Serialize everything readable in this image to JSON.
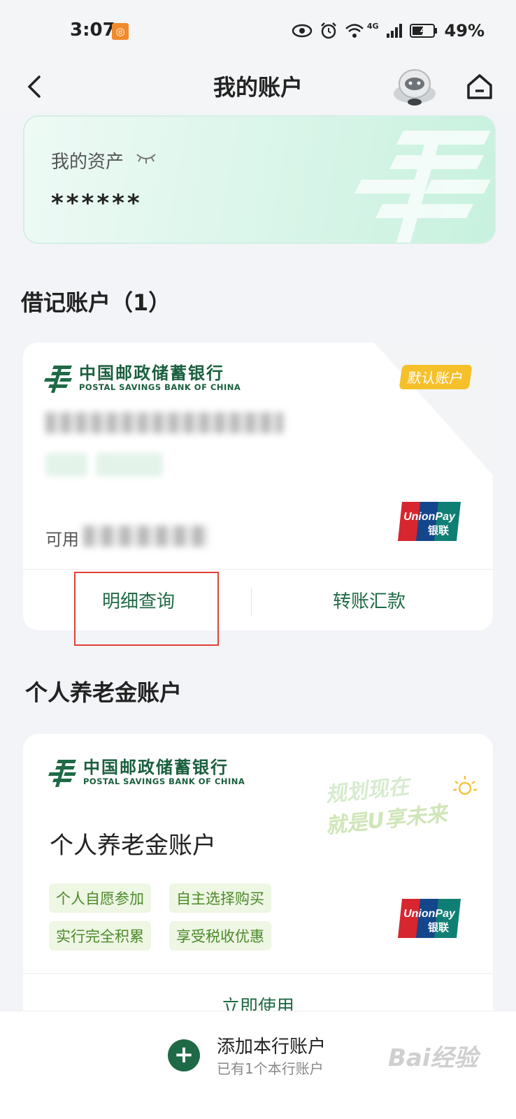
{
  "status_bar": {
    "time": "3:07",
    "battery": "49%",
    "network": "4G"
  },
  "header": {
    "title": "我的账户"
  },
  "assets": {
    "label": "我的资产",
    "value": "******"
  },
  "debit_section": {
    "title": "借记账户（1）"
  },
  "debit_card": {
    "bank_name_cn": "中国邮政储蓄银行",
    "bank_name_en": "POSTAL SAVINGS BANK OF CHINA",
    "badge": "默认账户",
    "available_label": "可用",
    "unionpay_en": "UnionPay",
    "unionpay_cn": "银联",
    "actions": [
      "明细查询",
      "转账汇款"
    ]
  },
  "pension_section": {
    "title": "个人养老金账户"
  },
  "pension_card": {
    "bank_name_cn": "中国邮政储蓄银行",
    "bank_name_en": "POSTAL SAVINGS BANK OF CHINA",
    "slogan_line1": "规划现在",
    "slogan_line2": "就是U享未来",
    "title": "个人养老金账户",
    "tags": [
      "个人自愿参加",
      "自主选择购买",
      "实行完全积累",
      "享受税收优惠"
    ],
    "unionpay_en": "UnionPay",
    "unionpay_cn": "银联",
    "action": "立即使用"
  },
  "bottom": {
    "add_title": "添加本行账户",
    "add_sub": "已有1个本行账户"
  },
  "watermark": "Bai经验",
  "colors": {
    "brand_green": "#1f6a46",
    "badge_yellow": "#f5c02a",
    "highlight_red": "#e04038"
  }
}
